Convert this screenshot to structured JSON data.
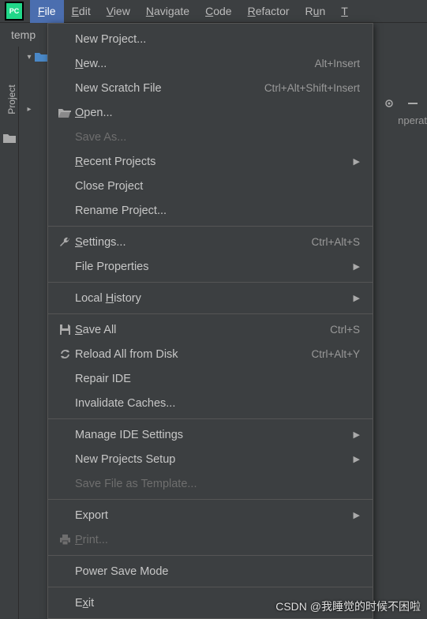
{
  "menubar": {
    "items": [
      {
        "label": "File",
        "mnemonic": "F",
        "active": true
      },
      {
        "label": "Edit",
        "mnemonic": "E"
      },
      {
        "label": "View",
        "mnemonic": "V"
      },
      {
        "label": "Navigate",
        "mnemonic": "N"
      },
      {
        "label": "Code",
        "mnemonic": "C"
      },
      {
        "label": "Refactor",
        "mnemonic": "R"
      },
      {
        "label": "Run",
        "mnemonic": "u",
        "prefix": "R"
      },
      {
        "label": "T",
        "partial": true
      }
    ]
  },
  "tab": {
    "label": "temp"
  },
  "side": {
    "label": "Project"
  },
  "right_text": "nperat",
  "dropdown": {
    "groups": [
      [
        {
          "label": "New Project...",
          "icon": "",
          "mn": ""
        },
        {
          "label": "New...",
          "mn": "N",
          "shortcut": "Alt+Insert"
        },
        {
          "label": "New Scratch File",
          "shortcut": "Ctrl+Alt+Shift+Insert"
        },
        {
          "label": "Open...",
          "mn": "O",
          "icon": "folder-open"
        },
        {
          "label": "Save As...",
          "disabled": true
        },
        {
          "label": "Recent Projects",
          "mn": "R",
          "submenu": true
        },
        {
          "label": "Close Project"
        },
        {
          "label": "Rename Project..."
        }
      ],
      [
        {
          "label": "Settings...",
          "mn": "S",
          "icon": "wrench",
          "shortcut": "Ctrl+Alt+S"
        },
        {
          "label": "File Properties",
          "submenu": true
        }
      ],
      [
        {
          "label": "Local History",
          "mn": "H",
          "pre": "Local ",
          "submenu": true
        }
      ],
      [
        {
          "label": "Save All",
          "mn": "S",
          "icon": "save",
          "shortcut": "Ctrl+S"
        },
        {
          "label": "Reload All from Disk",
          "icon": "reload",
          "shortcut": "Ctrl+Alt+Y"
        },
        {
          "label": "Repair IDE"
        },
        {
          "label": "Invalidate Caches..."
        }
      ],
      [
        {
          "label": "Manage IDE Settings",
          "submenu": true
        },
        {
          "label": "New Projects Setup",
          "submenu": true
        },
        {
          "label": "Save File as Template...",
          "disabled": true
        }
      ],
      [
        {
          "label": "Export",
          "submenu": true
        },
        {
          "label": "Print...",
          "mn": "P",
          "icon": "print",
          "disabled": true
        }
      ],
      [
        {
          "label": "Power Save Mode"
        }
      ],
      [
        {
          "label": "Exit",
          "mn": "x",
          "pre": "E"
        }
      ]
    ]
  },
  "watermark": "CSDN @我睡觉的时候不困啦"
}
